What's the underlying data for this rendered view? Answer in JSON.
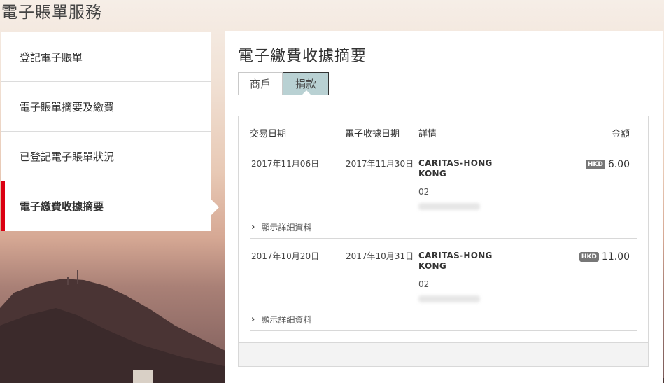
{
  "page": {
    "title": "電子賬單服務"
  },
  "sidebar": {
    "items": [
      {
        "label": "登記電子賬單"
      },
      {
        "label": "電子賬單摘要及繳費"
      },
      {
        "label": "已登記電子賬單狀況"
      },
      {
        "label": "電子繳費收據摘要",
        "active": true
      }
    ]
  },
  "panel": {
    "title": "電子繳費收據摘要",
    "tabs": [
      {
        "label": "商戶",
        "selected": false
      },
      {
        "label": "捐款",
        "selected": true
      }
    ],
    "table": {
      "headers": {
        "date": "交易日期",
        "receipt_date": "電子收據日期",
        "details": "詳情",
        "amount": "金額"
      },
      "rows": [
        {
          "date": "2017年11月06日",
          "receipt_date": "2017年11月30日",
          "name": "CARITAS-HONG KONG",
          "code": "02",
          "currency": "HKD",
          "amount": "6.00",
          "expand_label": "顯示詳細資料"
        },
        {
          "date": "2017年10月20日",
          "receipt_date": "2017年10月31日",
          "name": "CARITAS-HONG KONG",
          "code": "02",
          "currency": "HKD",
          "amount": "11.00",
          "expand_label": "顯示詳細資料"
        }
      ]
    }
  },
  "colors": {
    "accent": "#db0011",
    "tab_selected": "#b9d1d3",
    "badge": "#777777"
  }
}
